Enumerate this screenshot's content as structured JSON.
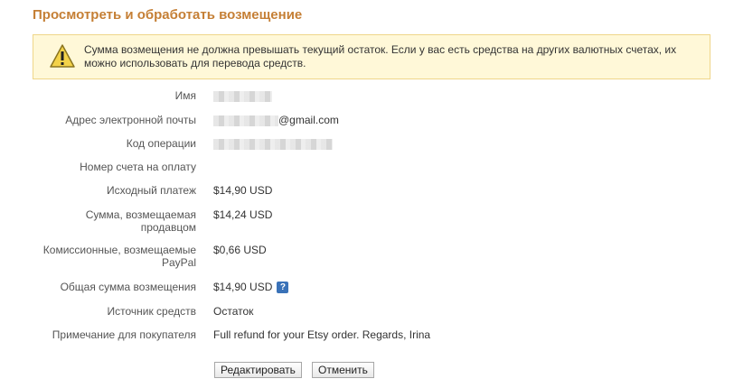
{
  "page": {
    "title": "Просмотреть и обработать возмещение"
  },
  "alert": {
    "text": "Сумма возмещения не должна превышать текущий остаток. Если у вас есть средства на других валютных счетах, их можно использовать для перевода средств."
  },
  "fields": {
    "name": {
      "label": "Имя",
      "value": ""
    },
    "email": {
      "label": "Адрес электронной почты",
      "value": "@gmail.com"
    },
    "transaction_id": {
      "label": "Код операции",
      "value": ""
    },
    "invoice_number": {
      "label": "Номер счета на оплату",
      "value": ""
    },
    "original_payment": {
      "label": "Исходный платеж",
      "value": "$14,90 USD"
    },
    "seller_refund": {
      "label": "Сумма, возмещаемая продавцом",
      "value": "$14,24 USD"
    },
    "paypal_fee_refund": {
      "label": "Комиссионные, возмещаемые PayPal",
      "value": "$0,66 USD"
    },
    "total_refund": {
      "label": "Общая сумма возмещения",
      "value": "$14,90 USD"
    },
    "funding_source": {
      "label": "Источник средств",
      "value": "Остаток"
    },
    "buyer_note": {
      "label": "Примечание для покупателя",
      "value": "Full refund for your Etsy order. Regards, Irina"
    }
  },
  "buttons": {
    "edit": "Редактировать",
    "cancel": "Отменить"
  },
  "icons": {
    "alert": "warning-triangle-icon",
    "help": "help-question-icon"
  },
  "colors": {
    "title": "#c57f35",
    "alert_bg": "#fff8d8",
    "alert_border": "#efd68a"
  }
}
